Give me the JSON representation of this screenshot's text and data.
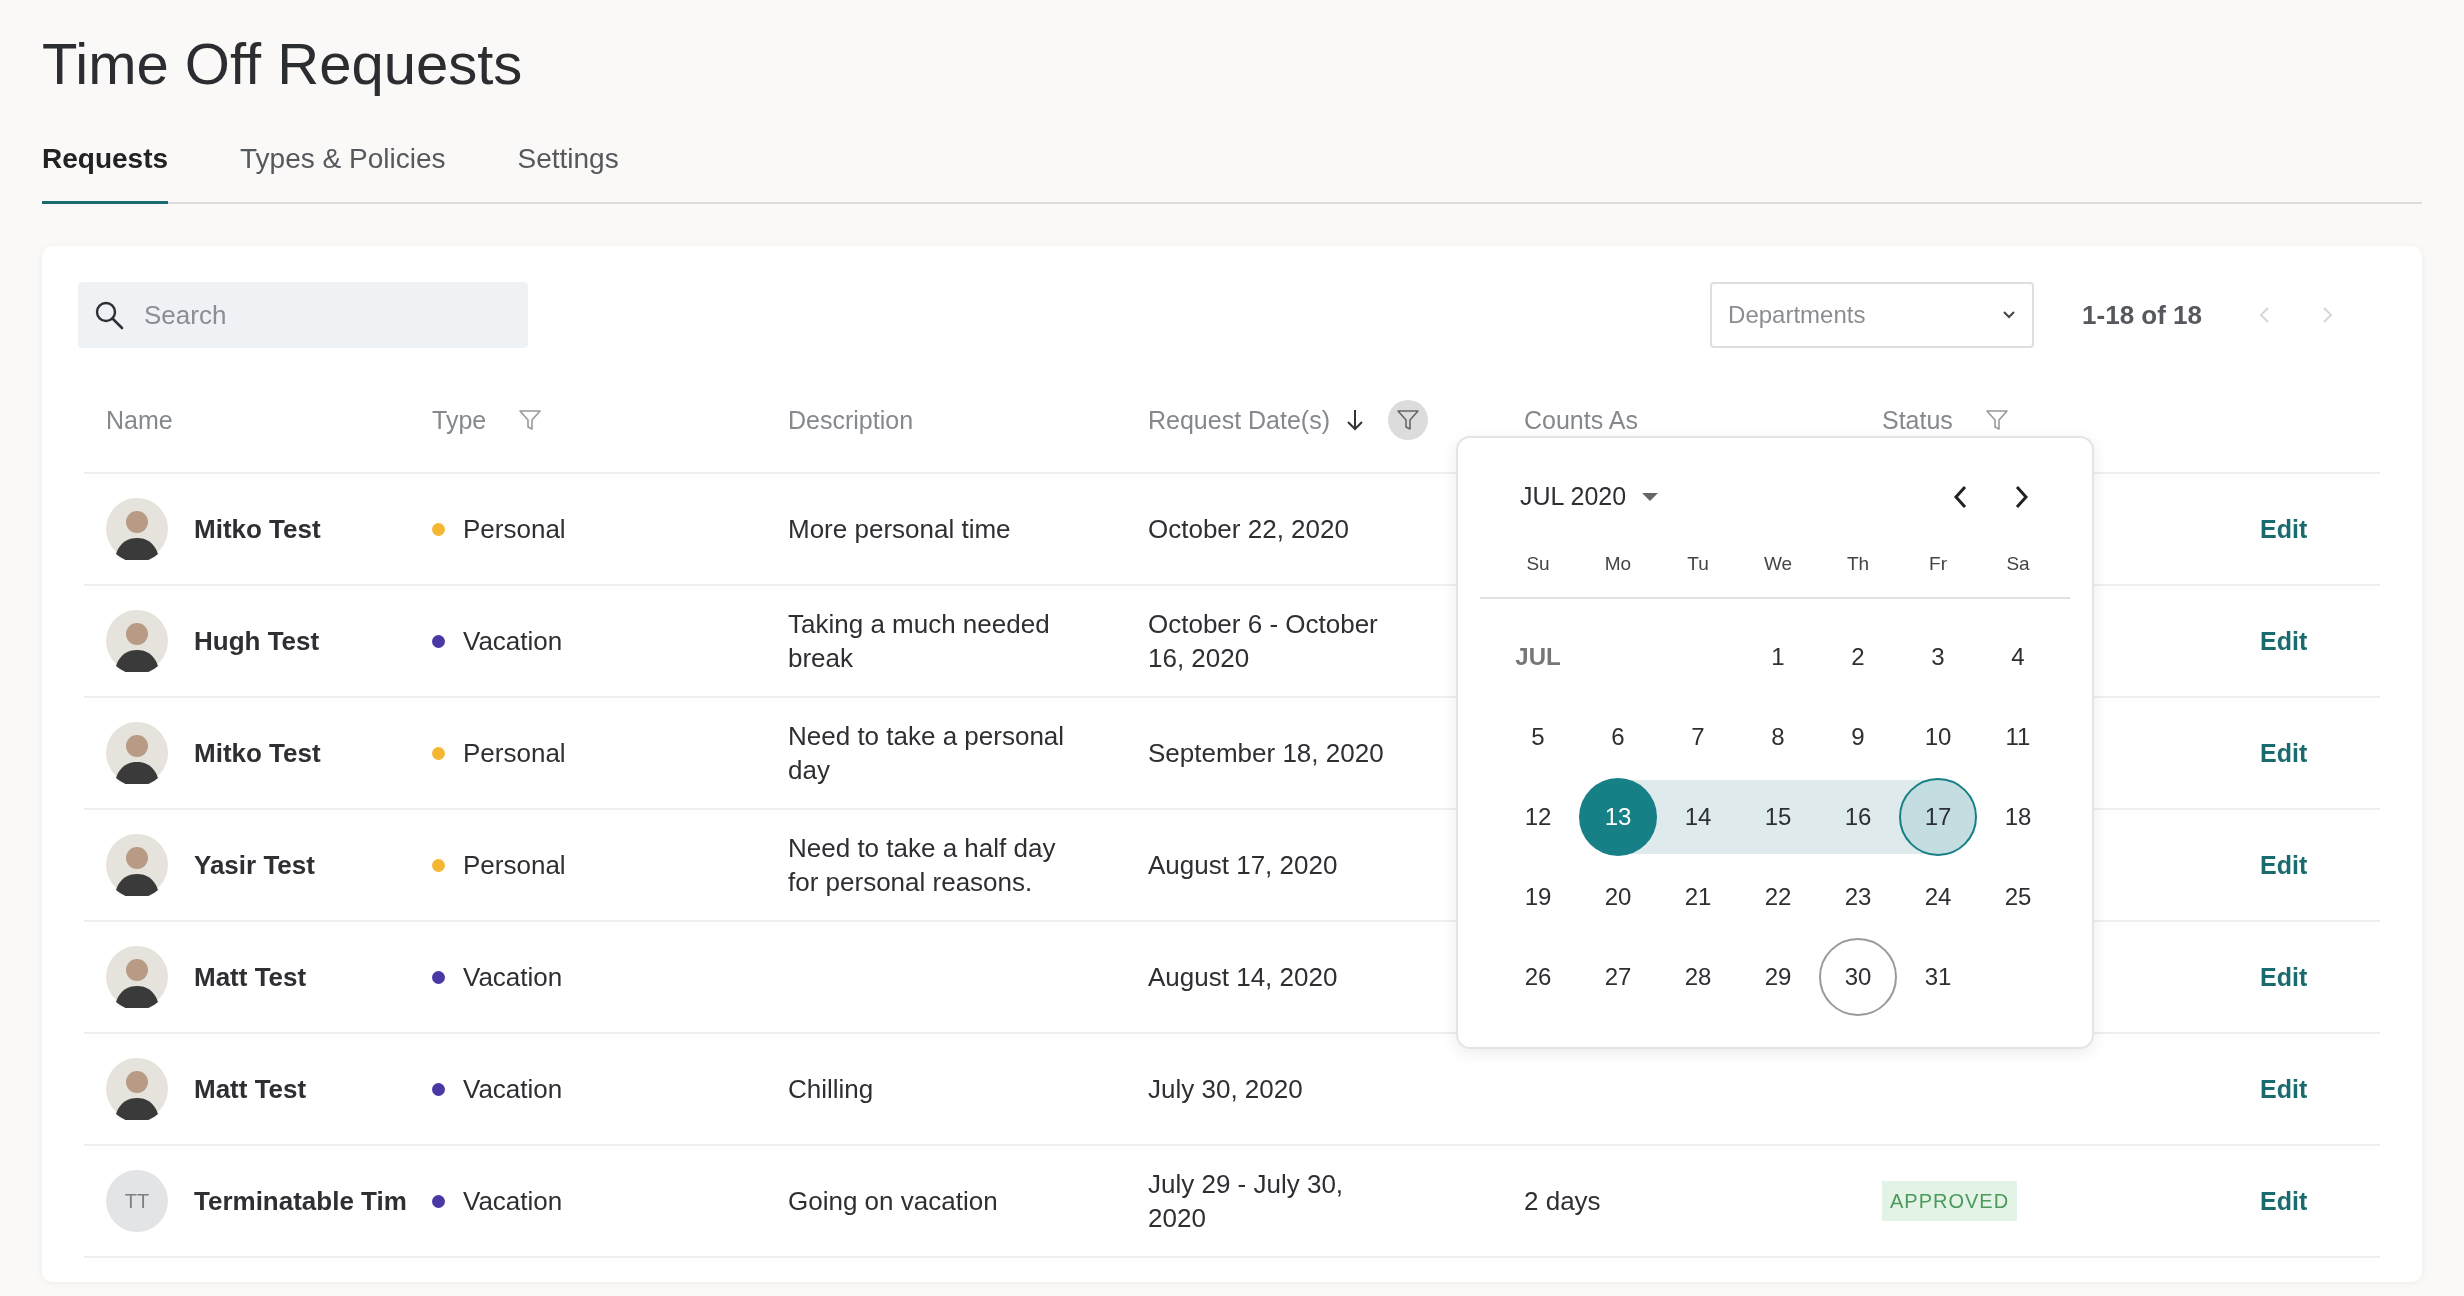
{
  "page": {
    "title": "Time Off Requests"
  },
  "tabs": [
    {
      "label": "Requests",
      "selected": true
    },
    {
      "label": "Types & Policies",
      "selected": false
    },
    {
      "label": "Settings",
      "selected": false
    }
  ],
  "toolbar": {
    "search": {
      "placeholder": "Search"
    },
    "departments": {
      "placeholder": "Departments"
    },
    "pagination": {
      "range": "1-18 of 18",
      "prev_disabled": true,
      "next_disabled": true
    }
  },
  "table": {
    "columns": [
      {
        "label": "Name",
        "sorted": false
      },
      {
        "label": "Type",
        "sorted": false,
        "filter_active": false
      },
      {
        "label": "Description",
        "sorted": false
      },
      {
        "label": "Request Date(s)",
        "sorted": true,
        "filter_active": true
      },
      {
        "label": "Counts As",
        "sorted": false
      },
      {
        "label": "Status",
        "sorted": false,
        "filter_active": false
      }
    ],
    "rows": [
      {
        "name": "Mitko Test",
        "type": "Personal",
        "color": "#f4b731",
        "description": "More personal time",
        "dates": "October 22, 2020",
        "action": "Edit"
      },
      {
        "name": "Hugh Test",
        "type": "Vacation",
        "color": "#4a38a6",
        "description": "Taking a much needed break",
        "dates": "October 6 - October 16, 2020",
        "action": "Edit"
      },
      {
        "name": "Mitko Test",
        "type": "Personal",
        "color": "#f4b731",
        "description": "Need to take a personal day",
        "dates": "September 18, 2020",
        "action": "Edit"
      },
      {
        "name": "Yasir Test",
        "type": "Personal",
        "color": "#f4b731",
        "description": "Need to take a half day for personal reasons.",
        "dates": "August 17, 2020",
        "action": "Edit"
      },
      {
        "name": "Matt Test",
        "type": "Vacation",
        "color": "#4a38a6",
        "dates": "August 14, 2020",
        "action": "Edit"
      },
      {
        "name": "Matt Test",
        "type": "Vacation",
        "color": "#4a38a6",
        "description": "Chilling",
        "dates": "July 30, 2020",
        "action": "Edit"
      },
      {
        "avatar": {
          "kind": "initials",
          "text": "TT"
        },
        "name": "Terminatable Tim",
        "type": "Vacation",
        "color": "#4a38a6",
        "description": "Going on vacation",
        "dates": "July 29 - July 30, 2020",
        "counts_as": "2 days",
        "status": "APPROVED",
        "action": "Edit"
      }
    ]
  },
  "date_picker": {
    "month": "JUL 2020",
    "weekdays": [
      "Su",
      "Mo",
      "Tu",
      "We",
      "Th",
      "Fr",
      "Sa"
    ],
    "month_tag": "JUL",
    "weeks": [
      {
        "days": [
          {
            "label": "1",
            "kind": "plain"
          },
          {
            "label": "2",
            "kind": "plain"
          },
          {
            "label": "3",
            "kind": "plain"
          },
          {
            "label": "4",
            "kind": "plain"
          }
        ]
      },
      {
        "days": [
          {
            "label": "5",
            "kind": "plain"
          },
          {
            "label": "6",
            "kind": "plain"
          },
          {
            "label": "7",
            "kind": "plain"
          },
          {
            "label": "8",
            "kind": "plain"
          },
          {
            "label": "9",
            "kind": "plain"
          },
          {
            "label": "10",
            "kind": "plain"
          },
          {
            "label": "11",
            "kind": "plain"
          }
        ]
      },
      {
        "days": [
          {
            "label": "12",
            "kind": "plain"
          },
          {
            "label": "13",
            "kind": "range_start"
          },
          {
            "label": "14",
            "kind": "in_range"
          },
          {
            "label": "15",
            "kind": "in_range"
          },
          {
            "label": "16",
            "kind": "in_range"
          },
          {
            "label": "17",
            "kind": "range_end"
          },
          {
            "label": "18",
            "kind": "plain"
          }
        ]
      },
      {
        "days": [
          {
            "label": "19",
            "kind": "plain"
          },
          {
            "label": "20",
            "kind": "plain"
          },
          {
            "label": "21",
            "kind": "plain"
          },
          {
            "label": "22",
            "kind": "plain"
          },
          {
            "label": "23",
            "kind": "plain"
          },
          {
            "label": "24",
            "kind": "plain"
          },
          {
            "label": "25",
            "kind": "plain"
          }
        ]
      },
      {
        "days": [
          {
            "label": "26",
            "kind": "plain"
          },
          {
            "label": "27",
            "kind": "plain"
          },
          {
            "label": "28",
            "kind": "plain"
          },
          {
            "label": "29",
            "kind": "plain"
          },
          {
            "label": "30",
            "kind": "today"
          },
          {
            "label": "31",
            "kind": "plain"
          }
        ]
      }
    ]
  }
}
